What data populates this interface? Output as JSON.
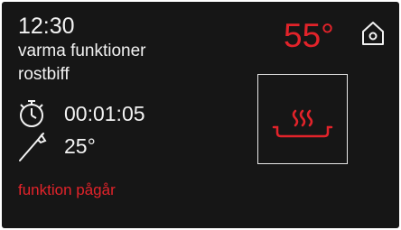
{
  "status_bar": {
    "time": "12:30"
  },
  "program": {
    "category": "varma funktioner",
    "name": "rostbiff"
  },
  "timer": {
    "icon": "stopwatch-icon",
    "value": "00:01:05"
  },
  "probe": {
    "icon": "meat-probe-icon",
    "value": "25°"
  },
  "status": {
    "text": "funktion pågår"
  },
  "oven": {
    "temperature": "55°"
  },
  "icons": {
    "home": "home-icon",
    "function": "steam-pot-icon"
  },
  "colors": {
    "background": "#161616",
    "text": "#f2f2f2",
    "accent_red": "#e2232a"
  }
}
